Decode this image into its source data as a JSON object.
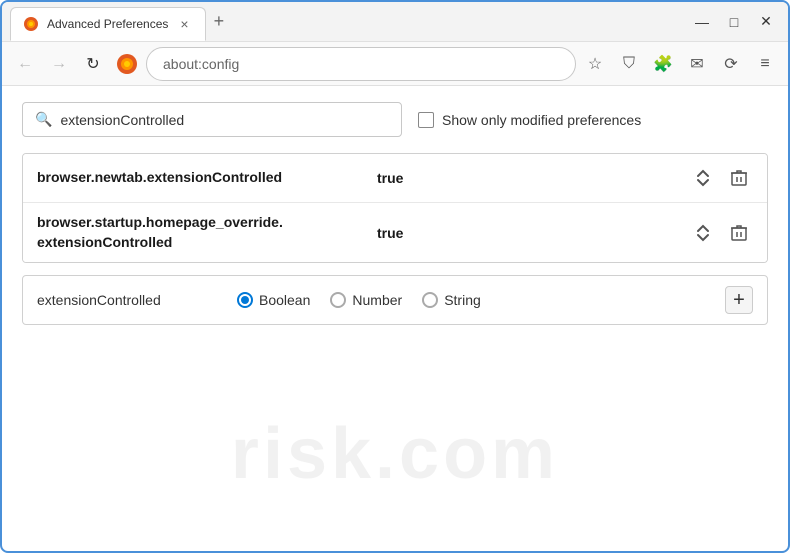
{
  "window": {
    "title": "Advanced Preferences",
    "tab_close": "×",
    "tab_new": "+",
    "win_minimize": "—",
    "win_restore": "□",
    "win_close": "✕"
  },
  "nav": {
    "back_label": "←",
    "forward_label": "→",
    "reload_label": "↻",
    "browser_name": "Firefox",
    "address_domain": "",
    "address_path": "about:config",
    "star_icon": "☆",
    "shield_icon": "⛉",
    "extension_icon": "🧩",
    "account_icon": "✉",
    "sync_icon": "⟳",
    "menu_icon": "≡"
  },
  "search": {
    "placeholder": "extensionControlled",
    "value": "extensionControlled",
    "checkbox_label": "Show only modified preferences"
  },
  "preferences": [
    {
      "name": "browser.newtab.extensionControlled",
      "value": "true"
    },
    {
      "name": "browser.startup.homepage_override.\nextensionControlled",
      "name_line1": "browser.startup.homepage_override.",
      "name_line2": "extensionControlled",
      "value": "true"
    }
  ],
  "add_preference": {
    "name": "extensionControlled",
    "types": [
      {
        "label": "Boolean",
        "selected": true
      },
      {
        "label": "Number",
        "selected": false
      },
      {
        "label": "String",
        "selected": false
      }
    ],
    "add_btn_label": "+"
  },
  "watermark": {
    "text": "risk.com"
  }
}
